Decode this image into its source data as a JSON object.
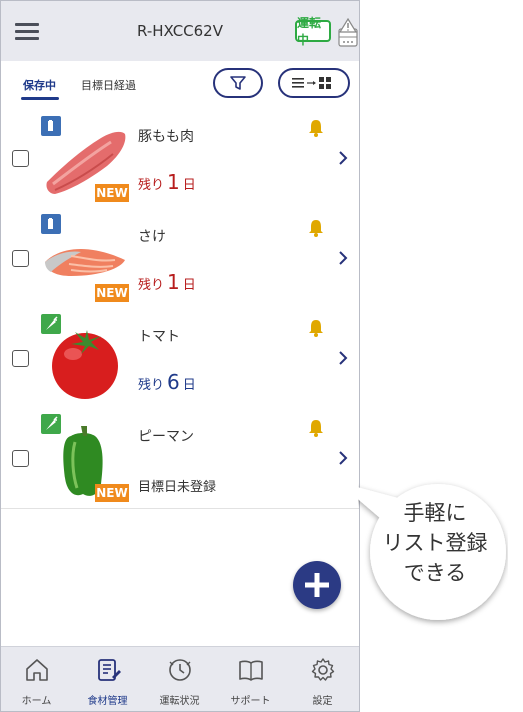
{
  "header": {
    "device_name": "R-HXCC62V",
    "status_badge": "運転中"
  },
  "tabs": [
    {
      "label": "保存中",
      "active": true
    },
    {
      "label": "目標日経過",
      "active": false
    }
  ],
  "items": [
    {
      "name": "豚もも肉",
      "category": "meat",
      "new": true,
      "remain_prefix": "残り",
      "remain_days": "1",
      "remain_suffix": "日",
      "status": "red",
      "image": "pork-loin"
    },
    {
      "name": "さけ",
      "category": "meat",
      "new": true,
      "remain_prefix": "残り",
      "remain_days": "1",
      "remain_suffix": "日",
      "status": "red",
      "image": "salmon-fillet"
    },
    {
      "name": "トマト",
      "category": "vegetable",
      "new": false,
      "remain_prefix": "残り",
      "remain_days": "6",
      "remain_suffix": "日",
      "status": "blue",
      "image": "tomato"
    },
    {
      "name": "ピーマン",
      "category": "vegetable",
      "new": true,
      "no_date_text": "目標日未登録",
      "image": "green-pepper"
    }
  ],
  "new_badge": "NEW",
  "bottom_nav": [
    {
      "label": "ホーム",
      "icon": "home-icon"
    },
    {
      "label": "食材管理",
      "icon": "food-management-icon",
      "active": true
    },
    {
      "label": "運転状況",
      "icon": "clock-icon"
    },
    {
      "label": "サポート",
      "icon": "book-icon"
    },
    {
      "label": "設定",
      "icon": "gear-icon"
    }
  ],
  "callout": {
    "line1": "手軽に",
    "line2": "リスト登録",
    "line3": "できる"
  },
  "colors": {
    "brand": "#27327a",
    "alert_red": "#b71c1c",
    "running_green": "#2eaa43",
    "new_orange": "#f08a1c",
    "bell_gold": "#e0a800"
  }
}
